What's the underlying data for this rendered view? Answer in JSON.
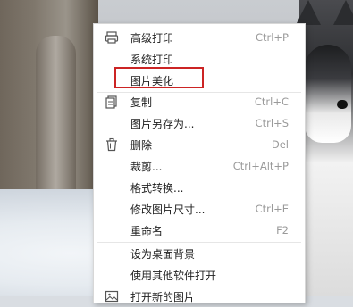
{
  "menu": {
    "items": [
      {
        "label": "高级打印",
        "shortcut": "Ctrl+P",
        "icon": "printer-icon"
      },
      {
        "label": "系统打印",
        "shortcut": "",
        "icon": ""
      },
      {
        "label": "图片美化",
        "shortcut": "",
        "icon": ""
      },
      {
        "label": "复制",
        "shortcut": "Ctrl+C",
        "icon": "copy-icon"
      },
      {
        "label": "图片另存为...",
        "shortcut": "Ctrl+S",
        "icon": ""
      },
      {
        "label": "删除",
        "shortcut": "Del",
        "icon": "trash-icon"
      },
      {
        "label": "裁剪...",
        "shortcut": "Ctrl+Alt+P",
        "icon": ""
      },
      {
        "label": "格式转换...",
        "shortcut": "",
        "icon": ""
      },
      {
        "label": "修改图片尺寸...",
        "shortcut": "Ctrl+E",
        "icon": ""
      },
      {
        "label": "重命名",
        "shortcut": "F2",
        "icon": ""
      },
      {
        "label": "设为桌面背景",
        "shortcut": "",
        "icon": ""
      },
      {
        "label": "使用其他软件打开",
        "shortcut": "",
        "icon": ""
      },
      {
        "label": "打开新的图片",
        "shortcut": "",
        "icon": "image-icon"
      }
    ]
  },
  "colors": {
    "highlight_border": "#cc2424"
  }
}
